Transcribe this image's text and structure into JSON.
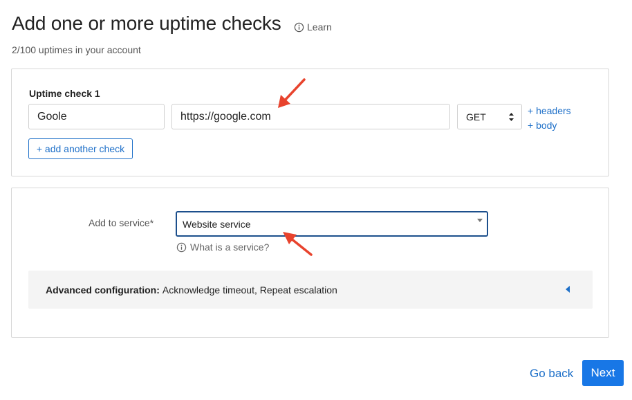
{
  "header": {
    "title": "Add one or more uptime checks",
    "learn_label": "Learn",
    "subtitle": "2/100 uptimes in your account"
  },
  "check": {
    "label": "Uptime check 1",
    "name_value": "Goole",
    "url_value": "https://google.com",
    "method": "GET",
    "headers_link": "+ headers",
    "body_link": "+ body",
    "add_button": "+ add another check"
  },
  "service": {
    "label": "Add to service*",
    "selected": "Website service",
    "help_link": "What is a service?"
  },
  "advanced": {
    "title": "Advanced configuration:",
    "summary": "Acknowledge timeout, Repeat escalation"
  },
  "footer": {
    "back_label": "Go back",
    "next_label": "Next"
  },
  "colors": {
    "accent": "#1d6fc8",
    "primary_button": "#1877e6",
    "annotation_arrow": "#e8432d"
  },
  "icons": [
    "info-icon",
    "up-down-caret-icon",
    "caret-down-icon",
    "caret-left-icon",
    "annotation-arrow"
  ]
}
